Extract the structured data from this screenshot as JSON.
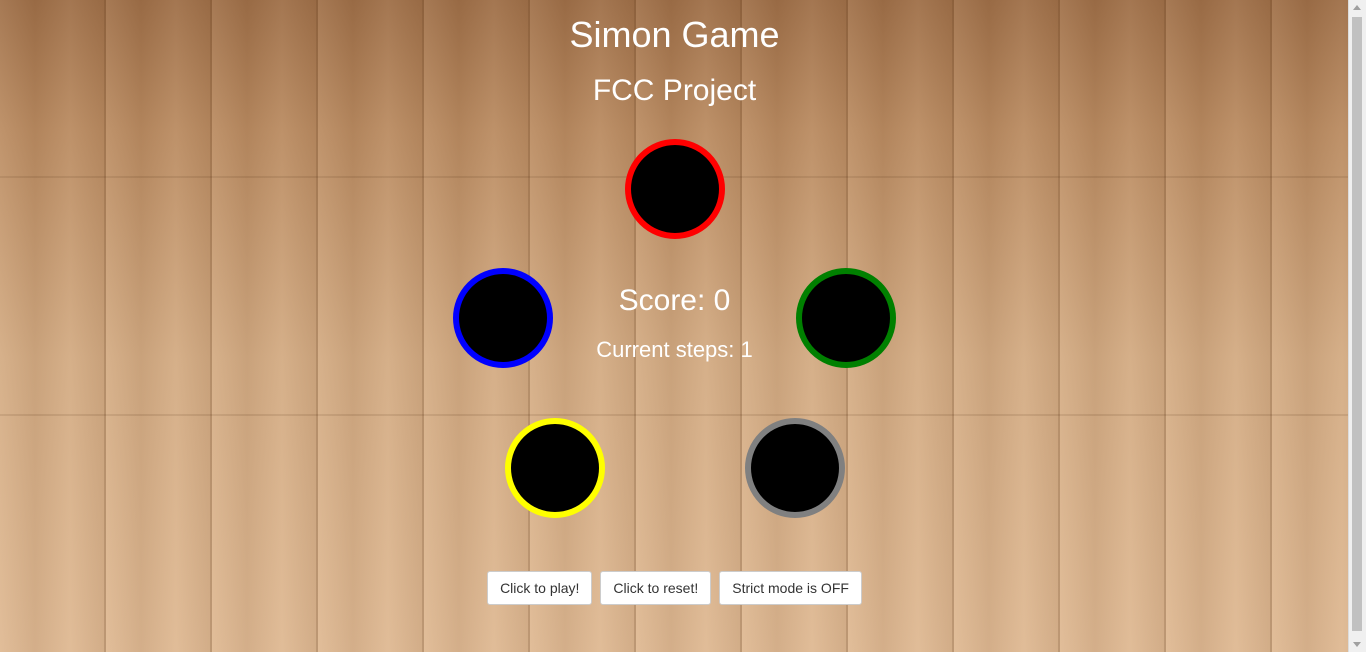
{
  "header": {
    "title": "Simon Game",
    "subtitle": "FCC Project"
  },
  "pads": [
    {
      "id": "red",
      "icon": "red-ring-button",
      "color": "#ff0000"
    },
    {
      "id": "blue",
      "icon": "blue-ring-button",
      "color": "#0000ff"
    },
    {
      "id": "green",
      "icon": "green-ring-button",
      "color": "#008000"
    },
    {
      "id": "yellow",
      "icon": "yellow-ring-button",
      "color": "#ffff00"
    },
    {
      "id": "gray",
      "icon": "gray-ring-button",
      "color": "#808080"
    }
  ],
  "status": {
    "score_label": "Score: 0",
    "steps_label": "Current steps: 1"
  },
  "controls": {
    "play_label": "Click to play!",
    "reset_label": "Click to reset!",
    "strict_label": "Strict mode is OFF"
  }
}
